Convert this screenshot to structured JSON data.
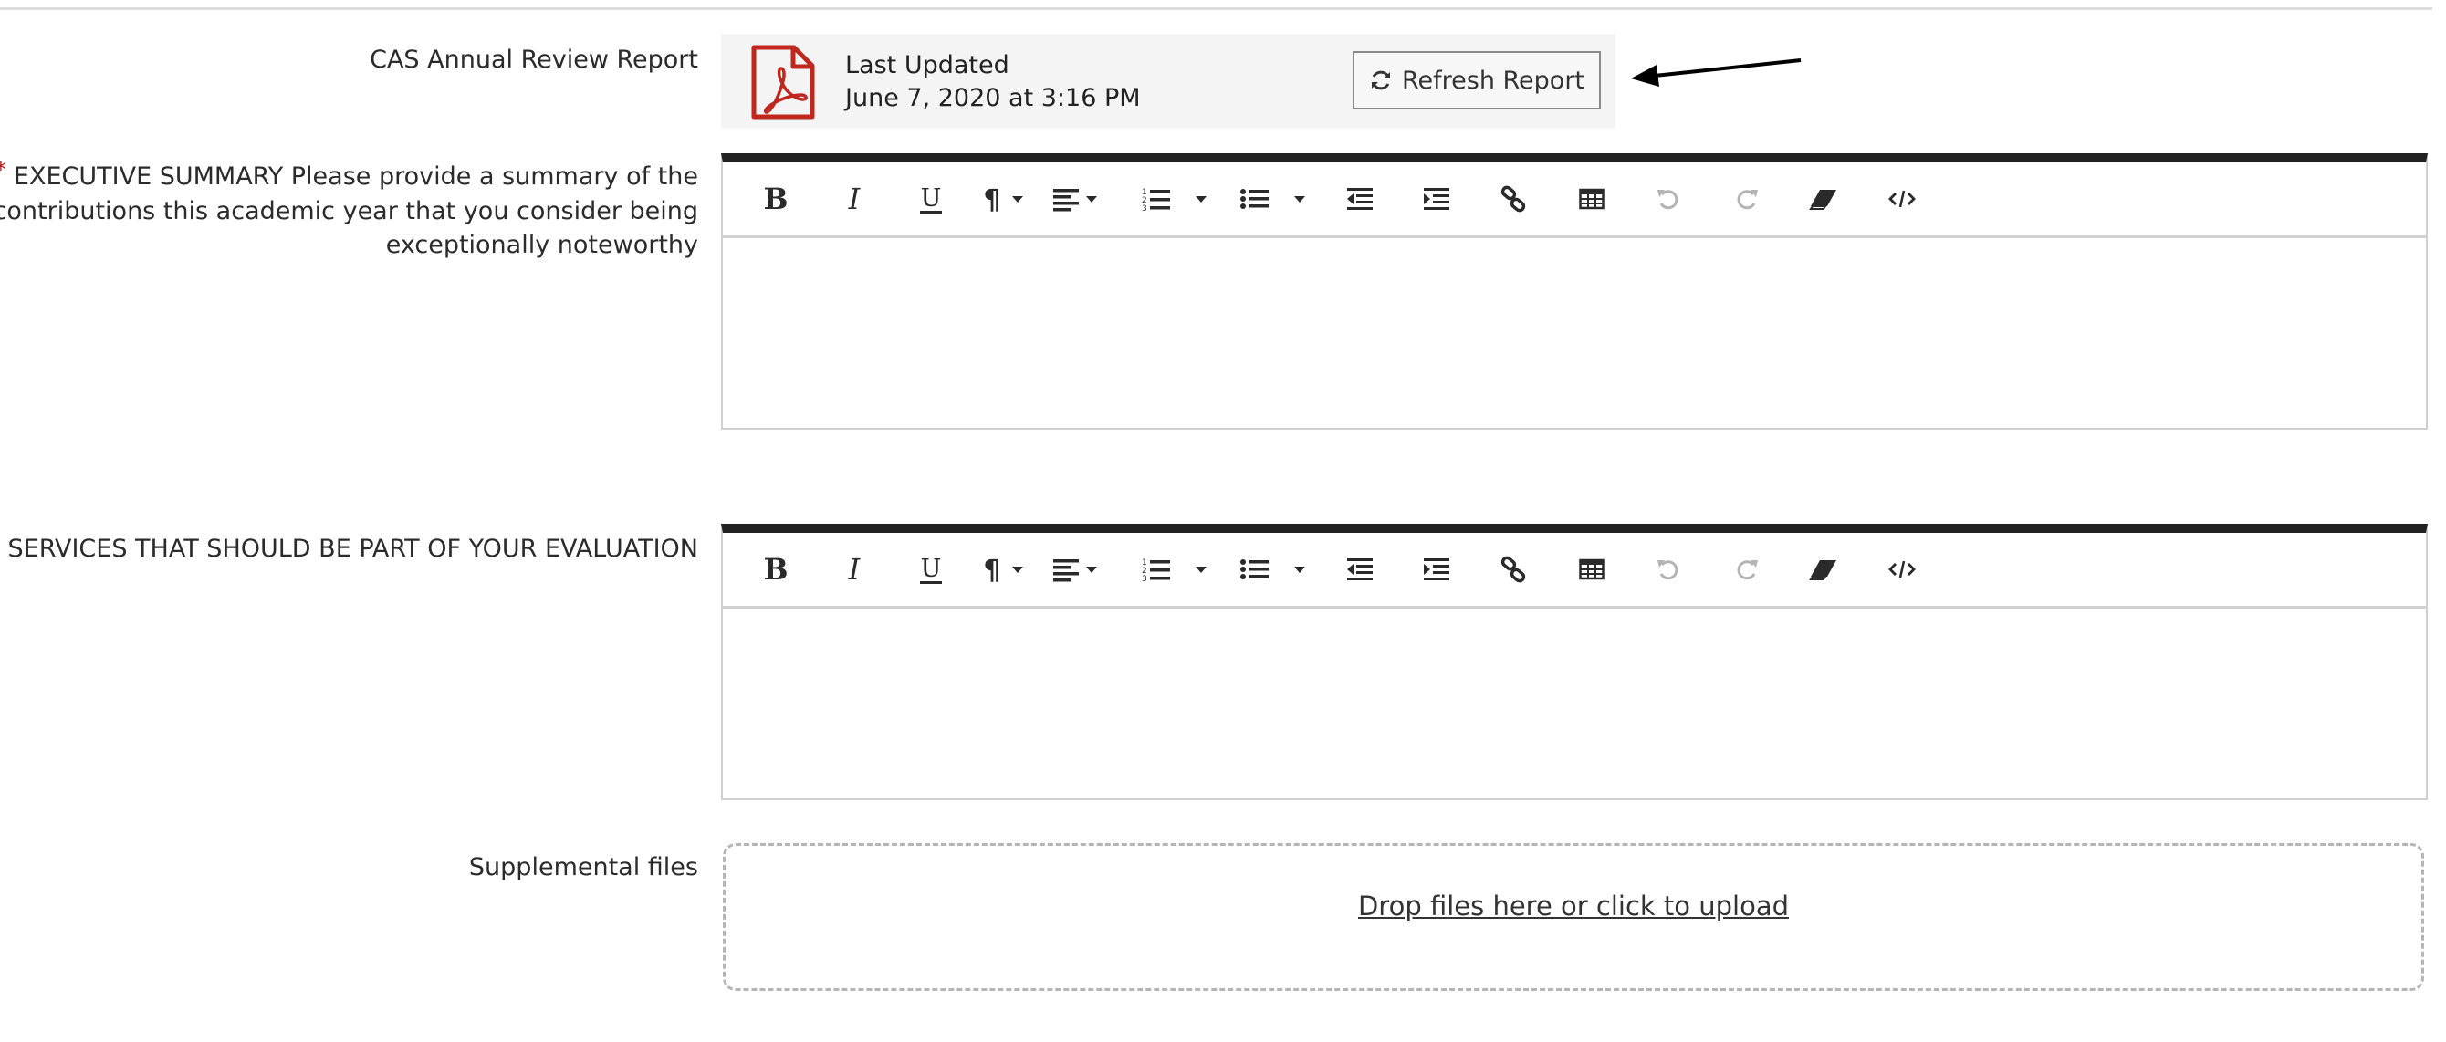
{
  "report_field": {
    "label": "CAS Annual Review Report",
    "last_updated_title": "Last Updated",
    "last_updated_date": "June 7, 2020 at 3:16 PM",
    "refresh_label": "Refresh Report"
  },
  "executive_summary": {
    "required_marker": "*",
    "label_line1": "EXECUTIVE SUMMARY Please provide a summary of the",
    "label_line2": "contributions this academic year that you consider being",
    "label_line3": "exceptionally noteworthy"
  },
  "other_services": {
    "label": "THER SERVICES THAT SHOULD BE PART OF YOUR EVALUATION"
  },
  "toolbar_icons": [
    "bold-icon",
    "italic-icon",
    "underline-icon",
    "paragraph-icon",
    "align-icon",
    "ordered-list-icon",
    "unordered-list-icon",
    "outdent-icon",
    "indent-icon",
    "link-icon",
    "table-icon",
    "undo-icon",
    "redo-icon",
    "eraser-icon",
    "code-view-icon"
  ],
  "supplemental": {
    "label": "Supplemental files",
    "dropzone_text": "Drop files here or click to upload"
  },
  "colors": {
    "required": "#b01a1a",
    "pdf_red": "#c0271f",
    "editor_top_border": "#222222"
  }
}
